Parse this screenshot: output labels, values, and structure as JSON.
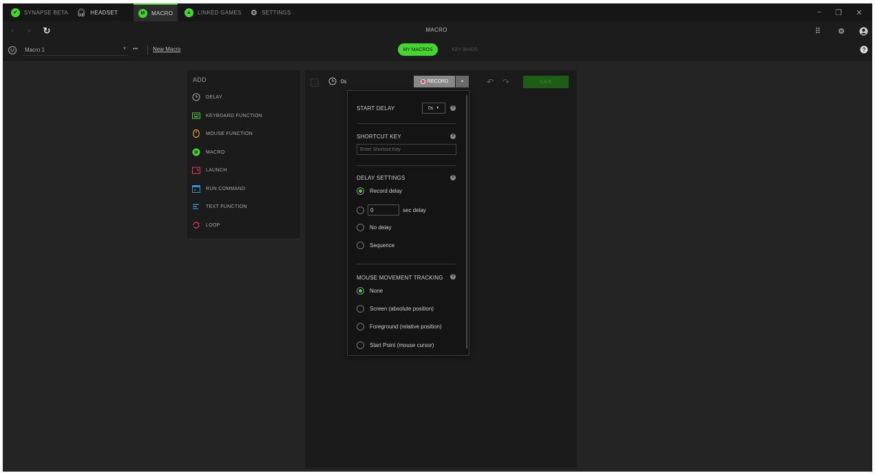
{
  "tabs": [
    {
      "label": "SYNAPSE BETA"
    },
    {
      "label": "HEADSET"
    },
    {
      "label": "MACRO"
    },
    {
      "label": "LINKED GAMES"
    },
    {
      "label": "SETTINGS"
    }
  ],
  "window_controls": {
    "minimize": "−",
    "maximize": "❐",
    "close": "✕"
  },
  "nav": {
    "title": "MACRO",
    "back": "‹",
    "forward": "›"
  },
  "subbar": {
    "macro_select": "Macro 1",
    "more": "•••",
    "new_macro": "New Macro",
    "toggle": {
      "active": "MY MACROS",
      "inactive": "KEY BINDS"
    }
  },
  "add_panel": {
    "title": "ADD",
    "items": [
      {
        "label": "DELAY",
        "icon": "clock-icon",
        "color": "#aaaaaa"
      },
      {
        "label": "KEYBOARD FUNCTION",
        "icon": "keyboard-icon",
        "color": "#44d62c"
      },
      {
        "label": "MOUSE FUNCTION",
        "icon": "mouse-icon",
        "color": "#f5a623"
      },
      {
        "label": "MACRO",
        "icon": "macro-icon",
        "color": "#44d62c"
      },
      {
        "label": "LAUNCH",
        "icon": "launch-icon",
        "color": "#e0405e"
      },
      {
        "label": "RUN COMMAND",
        "icon": "command-icon",
        "color": "#2e9bd6"
      },
      {
        "label": "TEXT FUNCTION",
        "icon": "text-icon",
        "color": "#2e9bd6"
      },
      {
        "label": "LOOP",
        "icon": "loop-icon",
        "color": "#e0405e"
      }
    ]
  },
  "editor": {
    "duration": "0s",
    "record_label": "RECORD",
    "save_label": "SAVE"
  },
  "record_menu": {
    "start_delay": {
      "label": "START DELAY",
      "value": "0s"
    },
    "shortcut": {
      "label": "SHORTCUT KEY",
      "placeholder": "Enter Shortcut Key"
    },
    "delay_settings": {
      "label": "DELAY SETTINGS",
      "options": [
        "Record delay",
        "sec delay",
        "No delay",
        "Sequence"
      ],
      "sec_value": "0",
      "selected": "Record delay"
    },
    "mouse_tracking": {
      "label": "MOUSE MOVEMENT TRACKING",
      "options": [
        "None",
        "Screen (absolute position)",
        "Foreground (relative position)",
        "Start Point (mouse cursor)"
      ],
      "selected": "None"
    }
  },
  "colors": {
    "accent": "#44d62c",
    "record": "#e0405e"
  }
}
